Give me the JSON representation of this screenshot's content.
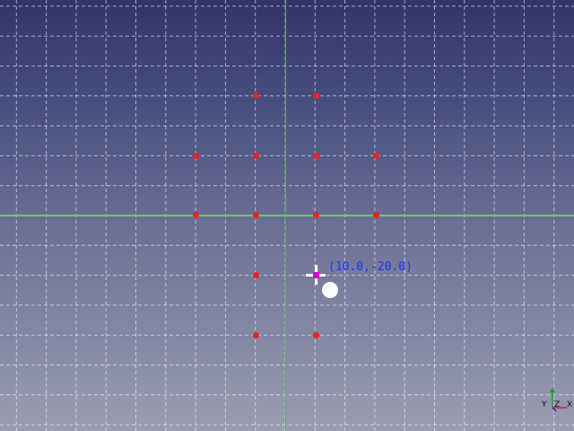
{
  "viewport": {
    "background_top": "#33336b",
    "background_bottom": "#9a9cb2",
    "grid_color": "#ffffff",
    "x_axis_color": "#66cc66",
    "y_axis_color": "#e06666"
  },
  "points": {
    "color": "#ee2222",
    "count": 14
  },
  "cursor": {
    "coordinate_label": "(10.0,-20.0)",
    "label_color": "#1a33ff",
    "crosshair_color": "#ffffff",
    "center_color": "#d000d0"
  },
  "axis_triad": {
    "z_label": "Z",
    "x_label": "X",
    "y_label": "Y"
  }
}
